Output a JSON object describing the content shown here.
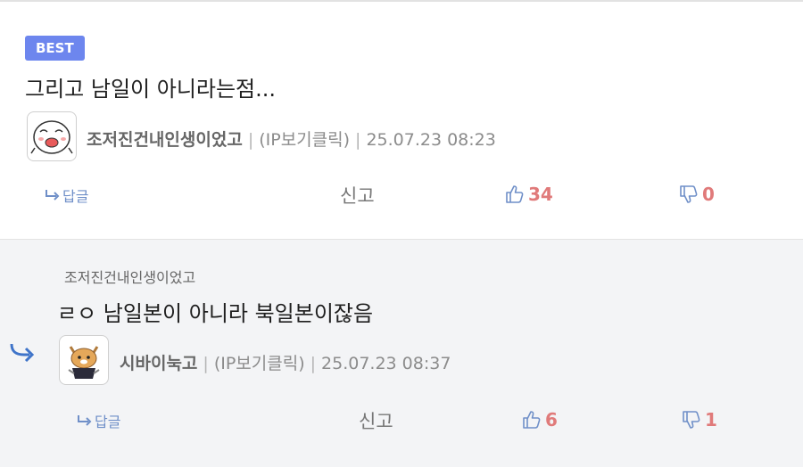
{
  "best_comment": {
    "badge": "BEST",
    "text": "그리고 남일이 아니라는점...",
    "nickname": "조저진건내인생이었고",
    "ip_label": "(IP보기클릭)",
    "timestamp": "25.07.23 08:23",
    "reply_label": "답글",
    "report_label": "신고",
    "upvotes": "34",
    "downvotes": "0",
    "avatar_icon": "cartoon-face-icon"
  },
  "reply_comment": {
    "parent_nickname": "조저진건내인생이었고",
    "text": "ㄹㅇ 남일본이 아니라 북일본이잖음",
    "nickname": "시바이눅고",
    "ip_label": "(IP보기클릭)",
    "timestamp": "25.07.23 08:37",
    "reply_label": "답글",
    "report_label": "신고",
    "upvotes": "6",
    "downvotes": "1",
    "avatar_icon": "shiba-dog-icon"
  },
  "colors": {
    "best_badge": "#6d86ee",
    "vote_count": "#e07a7a",
    "link_blue": "#6f8fc8",
    "reply_bg": "#f3f4f6"
  }
}
